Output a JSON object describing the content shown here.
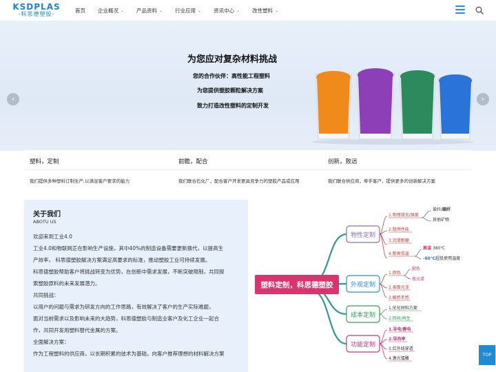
{
  "header": {
    "logo_main": "KSDPLAS",
    "logo_sub": "-科思德塑胶-",
    "nav": [
      {
        "label": "首页",
        "has_caret": false
      },
      {
        "label": "企业概况",
        "has_caret": true
      },
      {
        "label": "产品资料",
        "has_caret": true
      },
      {
        "label": "行业应用",
        "has_caret": true
      },
      {
        "label": "资讯中心",
        "has_caret": true
      },
      {
        "label": "改性塑料",
        "has_caret": true
      }
    ]
  },
  "banner": {
    "title": "为您应对复杂材料挑战",
    "line1": "您的合作伙伴：高性能工程塑料",
    "line2": "为您提供塑胶颗粒解决方案",
    "line3": "致力打造改性塑料的定制开发",
    "slides": 3,
    "active_slide": 1,
    "granule_colors": [
      "#f08a1a",
      "#8d3fb8",
      "#2d8a5c",
      "#2a73d8"
    ]
  },
  "features": [
    {
      "title": "塑料，定制",
      "desc": "我们提供多种塑料订制生产,以满足客户要求的能力"
    },
    {
      "title": "前瞻，配合",
      "desc": "我们联合石化厂，配合客户开发更具竞争力的塑胶产品或应用"
    },
    {
      "title": "创新，致远",
      "desc": "我们联合供应商，牵手客户，提供更多的创新解决方案"
    }
  ],
  "about": {
    "title": "关于我们",
    "subtitle": "ABOTU US",
    "paragraphs": [
      "欢迎来到工业4.0",
      "工业4.0和物联网正在影响生产设施，其中40%的制造设备需要更新换代，以提高生",
      "产效率， 科思德塑胶解决方案满足高要求的标准，推动塑胶工业可持续发展。",
      "科思德塑胶帮助客户将挑战转变为优势，在创新中需求发展，不断突破限制，共同探",
      "索塑胶原料的未来发展潜力。",
      "共同挑战：",
      "以用户的问题与需求为研发方向的工作思路，有效解决了客户的生产实际难题，",
      "面对当前需求以及影响未来的大趋势，科思德塑胶与制造业客户及化工企业一起合",
      "作，共同开发用塑料替代金属的方案。",
      "全面解决方案：",
      "作为工程塑料的供应商，以长期积累的技术为基础，向客户推荐理想的材料解决方案"
    ]
  },
  "mindmap": {
    "center": "塑料定制，科思德塑胶",
    "branches": [
      {
        "label": "物性定制",
        "items": [
          "1.物理填充/强度",
          "2.阻燃性能",
          "3.润滑耐磨",
          "4.耐高低温"
        ]
      },
      {
        "label": "外观定制",
        "items": [
          "1.颜色",
          "2.表面光泽",
          "3.触感手感"
        ]
      },
      {
        "label": "成本定制",
        "items": [
          "1.优化材料方案",
          "2.回收/再生"
        ]
      },
      {
        "label": "功能定制",
        "items": [
          "1.导电/静电",
          "2.导热率",
          "3.红外线穿透",
          "4.激光镭雕"
        ]
      }
    ],
    "sub_items": {
      "fiber_top": "玻纤/",
      "fiber_bold": "碳纤",
      "other_mineral": "其他矿物",
      "high_temp_label": "高温",
      "high_temp_value": "380℃",
      "low_temp_value": "-60℃",
      "low_temp_label": "超低使用温度",
      "color_match": "配色",
      "luminous": "夜光漆"
    },
    "branch_colors": {
      "purple": "#8a6fb6",
      "blue": "#2f8ed8",
      "green": "#3b9a5a",
      "magenta": "#c7347a",
      "center": "#d8356f"
    }
  },
  "back_to_top": "TOP"
}
